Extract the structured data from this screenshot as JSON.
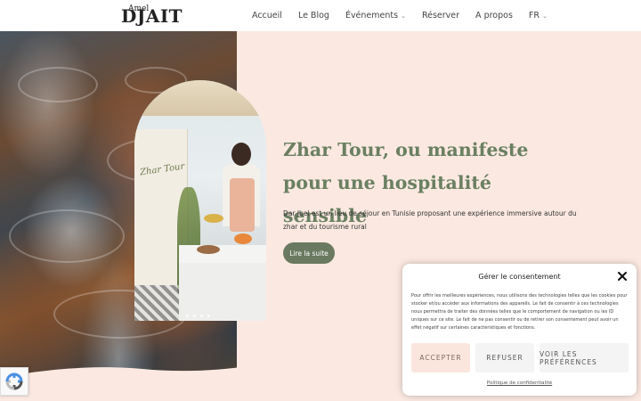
{
  "header": {
    "logo_small": "Amel",
    "logo_big": "DJAIT",
    "nav": [
      {
        "label": "Accueil",
        "has_dropdown": false
      },
      {
        "label": "Le Blog",
        "has_dropdown": false
      },
      {
        "label": "Événements",
        "has_dropdown": true
      },
      {
        "label": "Réserver",
        "has_dropdown": false
      },
      {
        "label": "A propos",
        "has_dropdown": false
      },
      {
        "label": "FR",
        "has_dropdown": true
      }
    ]
  },
  "hero": {
    "title": "Zhar Tour, ou manifeste pour une hospitalité sensible",
    "description": "Dar Jbel est un lieu de séjour en Tunisie proposant une expérience immersive autour du zhar et du tourisme rural",
    "button_label": "Lire la suite",
    "banner_text": "Zhar Tour",
    "slider_dots": 4
  },
  "consent": {
    "title": "Gérer le consentement",
    "text": "Pour offrir les meilleures expériences, nous utilisons des technologies telles que les cookies pour stocker et/ou accéder aux informations des appareils. Le fait de consentir à ces technologies nous permettra de traiter des données telles que le comportement de navigation ou les ID uniques sur ce site. Le fait de ne pas consentir ou de retirer son consentement peut avoir un effet négatif sur certaines caractéristiques et fonctions.",
    "accept": "ACCEPTER",
    "refuse": "REFUSER",
    "preferences": "VOIR LES PRÉFÉRENCES",
    "policy_link": "Politique de confidentialité"
  },
  "colors": {
    "page_bg": "#fbe9e1",
    "accent_green": "#6a8061",
    "button_green": "#6a7a61",
    "accept_bg": "#fbe6dd"
  },
  "icons": [
    "chevron-down-icon",
    "close-icon",
    "recaptcha-icon"
  ]
}
